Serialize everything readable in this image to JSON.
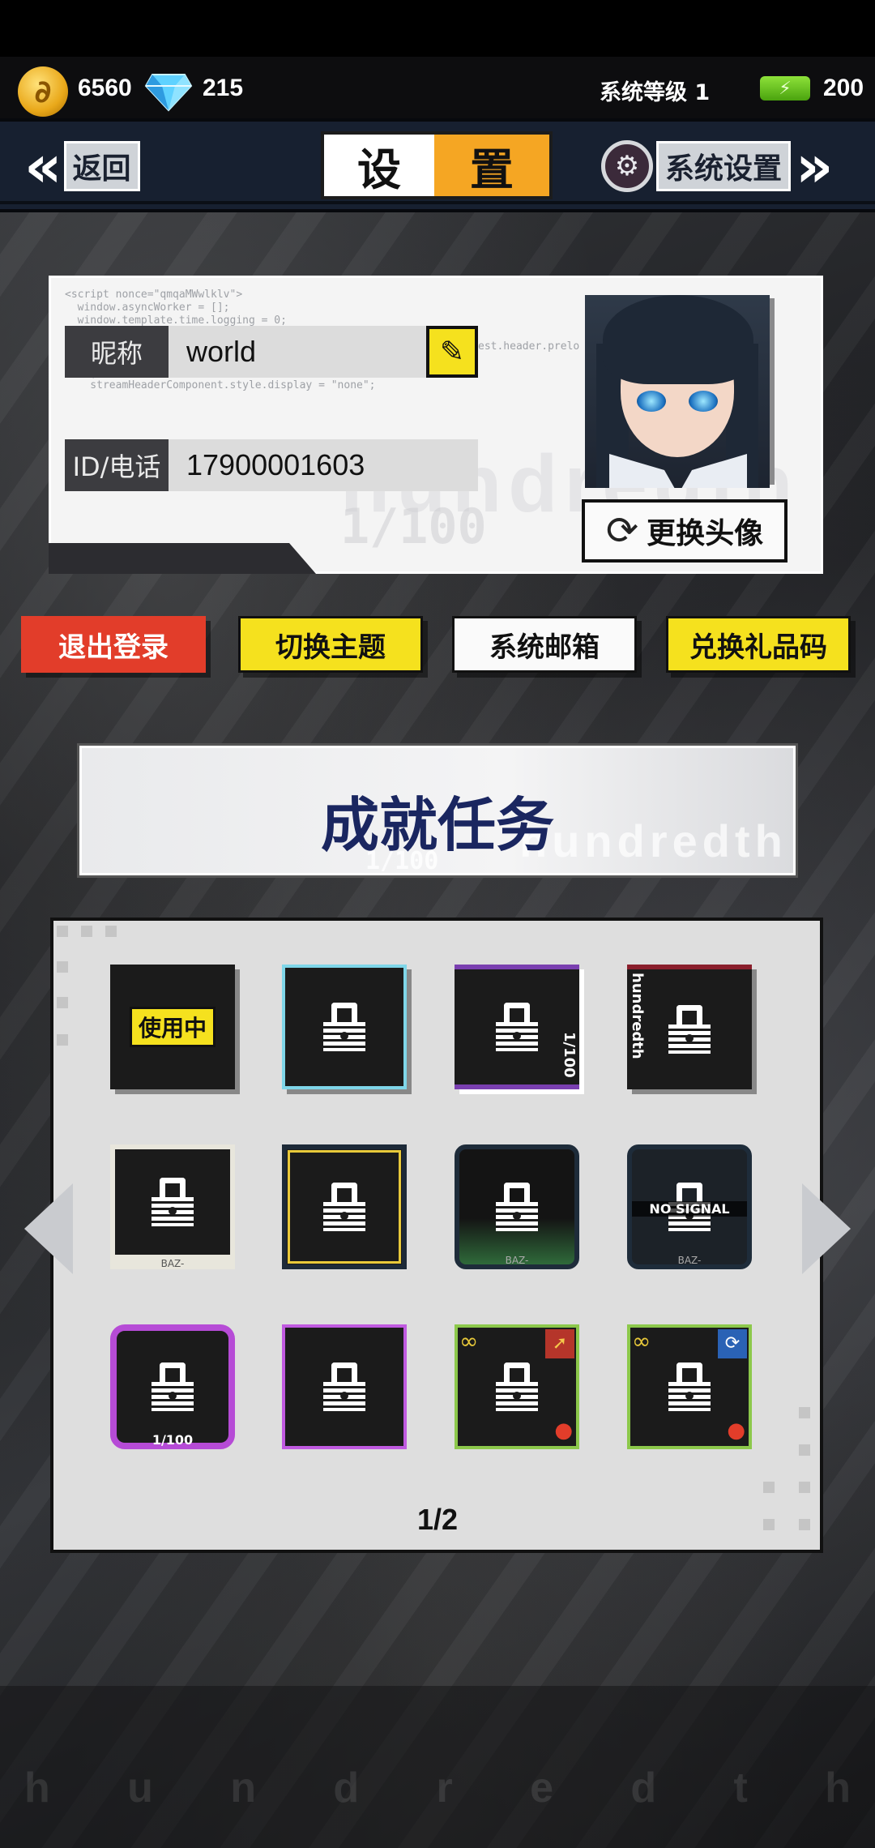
{
  "resources": {
    "coins": "6560",
    "gems": "215",
    "system_level": "系统等级 1",
    "energy": "200"
  },
  "nav": {
    "back_label": "返回",
    "title_part1": "设",
    "title_part2": "置",
    "settings_label": "系统设置"
  },
  "profile": {
    "nickname_label": "昵称",
    "nickname_value": "world",
    "id_label": "ID/电话",
    "id_value": "17900001603",
    "change_avatar_label": "更换头像",
    "code_overlay": "<script nonce=\"qmqaMWwlklv\">\n  window.asyncWorker = [];\n  window.template.time.logging = 0;\n\n\n    streamHeaderComponent.style = \"\"\n    |\n    streamHeaderComponent.style.display = \"none\";",
    "code_overlay_right": "est.header.prelo",
    "watermark_word": "hundredth",
    "watermark_fraction": "1/100"
  },
  "actions": {
    "logout": "退出登录",
    "switch_theme": "切换主题",
    "mailbox": "系统邮箱",
    "redeem_code": "兑换礼品码"
  },
  "achievement": {
    "title": "成就任务",
    "watermark_word": "hundredth",
    "watermark_fraction": "1/100"
  },
  "frames": {
    "in_use_label": "使用中",
    "frame3_text": "1/100",
    "frame4_text": "hundredth",
    "frame5_text": "BAZ-",
    "frame7_text": "BAZ-",
    "frame8_text": "BAZ-",
    "frame8_overlay": "NO SIGNAL",
    "frame9_text": "1/100",
    "page_indicator": "1/2"
  },
  "bottom_watermark": [
    "h",
    "u",
    "n",
    "d",
    "r",
    "e",
    "d",
    "t",
    "h"
  ],
  "colors": {
    "accent_yellow": "#f5e11e",
    "accent_orange": "#f5a623",
    "logout_red": "#e23d2a",
    "achievement_navy": "#1a2660"
  }
}
